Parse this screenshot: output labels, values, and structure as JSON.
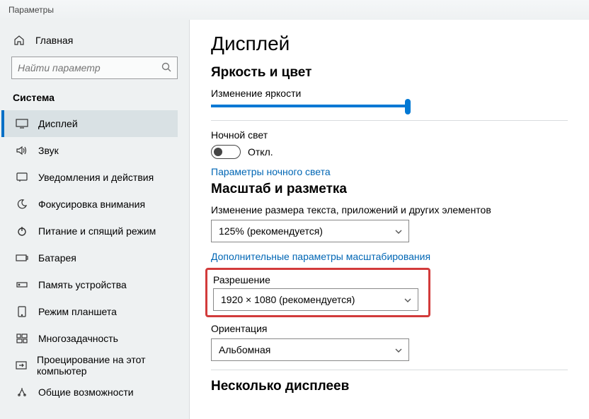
{
  "window": {
    "title": "Параметры"
  },
  "sidebar": {
    "home": "Главная",
    "search_placeholder": "Найти параметр",
    "section": "Система",
    "items": [
      {
        "label": "Дисплей",
        "icon": "display",
        "selected": true
      },
      {
        "label": "Звук",
        "icon": "sound"
      },
      {
        "label": "Уведомления и действия",
        "icon": "notifications"
      },
      {
        "label": "Фокусировка внимания",
        "icon": "focus"
      },
      {
        "label": "Питание и спящий режим",
        "icon": "power"
      },
      {
        "label": "Батарея",
        "icon": "battery"
      },
      {
        "label": "Память устройства",
        "icon": "storage"
      },
      {
        "label": "Режим планшета",
        "icon": "tablet"
      },
      {
        "label": "Многозадачность",
        "icon": "multitask"
      },
      {
        "label": "Проецирование на этот компьютер",
        "icon": "project"
      },
      {
        "label": "Общие возможности",
        "icon": "shared"
      }
    ]
  },
  "main": {
    "title": "Дисплей",
    "brightness_section": "Яркость и цвет",
    "brightness_label": "Изменение яркости",
    "night_light_label": "Ночной свет",
    "toggle_off": "Откл.",
    "night_light_link": "Параметры ночного света",
    "scale_section": "Масштаб и разметка",
    "scale_label": "Изменение размера текста, приложений и других элементов",
    "scale_value": "125% (рекомендуется)",
    "scale_link": "Дополнительные параметры масштабирования",
    "resolution_label": "Разрешение",
    "resolution_value": "1920 × 1080 (рекомендуется)",
    "orientation_label": "Ориентация",
    "orientation_value": "Альбомная",
    "multi_section": "Несколько дисплеев"
  },
  "colors": {
    "accent": "#0078d4",
    "link": "#0066b4",
    "annotation_red": "#d23b3b",
    "annotation_green": "#1aae82"
  }
}
